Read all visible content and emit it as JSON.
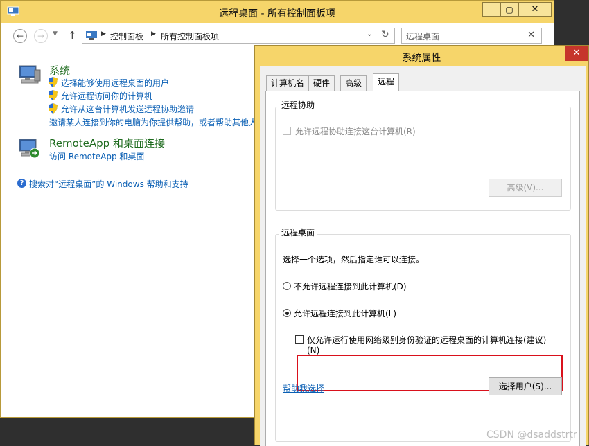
{
  "control_panel": {
    "title": "远程桌面 - 所有控制面板项",
    "buttons": {
      "minimize": "—",
      "maximize": "▢",
      "close": "✕"
    },
    "breadcrumb": [
      "控制面板",
      "所有控制面板项"
    ],
    "search": {
      "placeholder": "远程桌面"
    },
    "sections": {
      "system": {
        "heading": "系统",
        "links": [
          "选择能够使用远程桌面的用户",
          "允许远程访问你的计算机",
          "允许从这台计算机发送远程协助邀请",
          "邀请某人连接到你的电脑为你提供帮助，或者帮助其他人"
        ]
      },
      "remoteapp": {
        "heading": "RemoteApp 和桌面连接",
        "links": [
          "访问 RemoteApp 和桌面"
        ]
      },
      "help_link": "搜索对“远程桌面”的 Windows 帮助和支持"
    }
  },
  "system_properties": {
    "title": "系统属性",
    "close": "✕",
    "tabs": [
      "计算机名",
      "硬件",
      "高级",
      "远程"
    ],
    "remote_assistance": {
      "group_title": "远程协助",
      "checkbox_label": "允许远程协助连接这台计算机(R)",
      "advanced_button": "高级(V)..."
    },
    "remote_desktop": {
      "group_title": "远程桌面",
      "instruction": "选择一个选项，然后指定谁可以连接。",
      "option_deny": "不允许远程连接到此计算机(D)",
      "option_allow": "允许远程连接到此计算机(L)",
      "nla_label_line1": "仅允许运行使用网络级别身份验证的远程桌面的计算机连接(建议)",
      "nla_label_line2": "(N)",
      "help_link": "帮助我选择",
      "select_users_button": "选择用户(S)..."
    }
  },
  "watermark": "CSDN @dsaddstrtr"
}
